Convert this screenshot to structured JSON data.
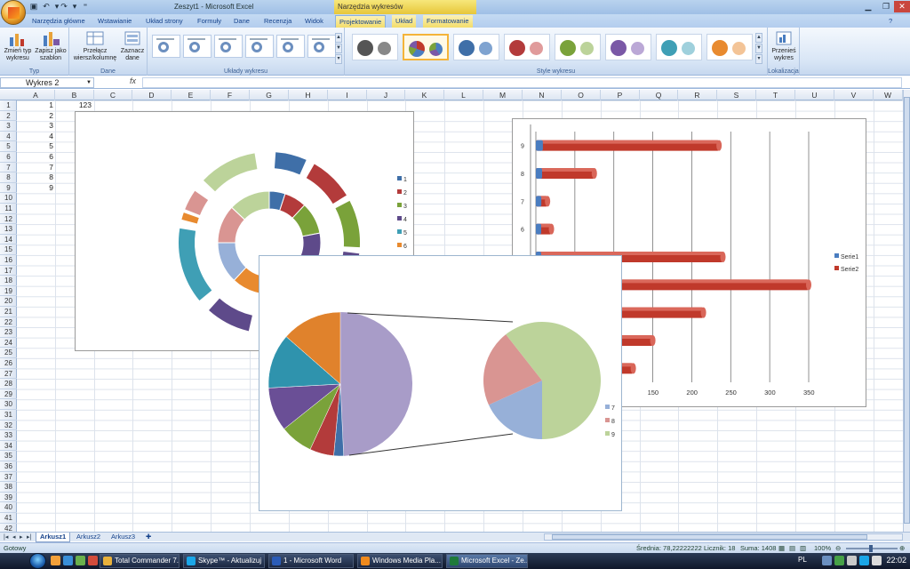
{
  "window": {
    "title": "Zeszyt1 - Microsoft Excel",
    "context_tab_title": "Narzędzia wykresów"
  },
  "ribbon": {
    "tabs": [
      {
        "label": "Narzędzia główne"
      },
      {
        "label": "Wstawianie"
      },
      {
        "label": "Układ strony"
      },
      {
        "label": "Formuły"
      },
      {
        "label": "Dane"
      },
      {
        "label": "Recenzja"
      },
      {
        "label": "Widok"
      },
      {
        "label": "Projektowanie"
      },
      {
        "label": "Układ"
      },
      {
        "label": "Formatowanie"
      }
    ],
    "active_tab": "Projektowanie",
    "groups": {
      "typ": {
        "label": "Typ",
        "change_type": "Zmień typ wykresu",
        "save_template": "Zapisz jako szablon"
      },
      "dane": {
        "label": "Dane",
        "switch_row_col": "Przełącz wiersz/kolumnę",
        "select_data": "Zaznacz dane"
      },
      "uklady": {
        "label": "Układy wykresu"
      },
      "style": {
        "label": "Style wykresu"
      },
      "lokalizacja": {
        "label": "Lokalizacja",
        "move_chart": "Przenieś wykres"
      }
    },
    "style_colors": [
      "#555555",
      "#4a7dc0",
      "#3f6fa8",
      "#b33b3b",
      "#7aa23a",
      "#7a58a6",
      "#3f9fb5",
      "#e88a2f"
    ]
  },
  "formula_bar": {
    "name_box": "Wykres 2",
    "fx": "fx",
    "value": ""
  },
  "columns": [
    "A",
    "B",
    "C",
    "D",
    "E",
    "F",
    "G",
    "H",
    "I",
    "J",
    "K",
    "L",
    "M",
    "N",
    "O",
    "P",
    "Q",
    "R",
    "S",
    "T",
    "U",
    "V",
    "W"
  ],
  "rows": [
    "1",
    "2",
    "3",
    "4",
    "5",
    "6",
    "7",
    "8",
    "9",
    "10",
    "11",
    "12",
    "13",
    "14",
    "15",
    "16",
    "17",
    "18",
    "19",
    "20",
    "21",
    "22",
    "23",
    "24",
    "25",
    "26",
    "27",
    "28",
    "29",
    "30",
    "31",
    "32",
    "33",
    "34",
    "35",
    "36",
    "37",
    "38",
    "39",
    "40",
    "41",
    "42"
  ],
  "cells": {
    "A": [
      "1",
      "2",
      "3",
      "4",
      "5",
      "6",
      "7",
      "8",
      "9"
    ],
    "B1": "123"
  },
  "chart_data": [
    {
      "type": "pie",
      "subtype": "doughnut",
      "categories": [
        "1",
        "2",
        "3",
        "4",
        "5",
        "6",
        "7",
        "8",
        "9"
      ],
      "legend_position": "right",
      "colors": [
        "#3f6fa8",
        "#b33b3b",
        "#7aa23a",
        "#5e4a8a",
        "#3f9fb5",
        "#e88a2f",
        "#97b0d8",
        "#d99592",
        "#bcd39a"
      ]
    },
    {
      "type": "bar",
      "subtype": "horizontal-3d",
      "categories": [
        "1",
        "2",
        "3",
        "4",
        "5",
        "6",
        "7",
        "8",
        "9"
      ],
      "series": [
        {
          "name": "Serie1",
          "values": [
            1,
            2,
            3,
            4,
            5,
            6,
            7,
            8,
            9
          ],
          "color": "#4a7dc0"
        },
        {
          "name": "Serie2",
          "values": [
            125,
            150,
            215,
            350,
            240,
            20,
            15,
            75,
            235
          ],
          "color": "#c0392b"
        }
      ],
      "xlim": [
        0,
        350
      ],
      "xticks": [
        "0",
        "50",
        "100",
        "150",
        "200",
        "250",
        "300",
        "350"
      ],
      "grid": true,
      "legend_position": "right"
    },
    {
      "type": "pie",
      "subtype": "pie-of-pie",
      "categories": [
        "1",
        "2",
        "3",
        "4",
        "5",
        "6",
        "7",
        "8",
        "9"
      ],
      "values": [
        9,
        22,
        30,
        40,
        50,
        55,
        60,
        70,
        200
      ],
      "legend_visible": [
        "7",
        "8",
        "9"
      ],
      "colors": [
        "#3f6fa8",
        "#b33b3b",
        "#7aa23a",
        "#6a4f96",
        "#2f93ad",
        "#e0822c",
        "#97b0d8",
        "#d99592",
        "#bcd39a"
      ],
      "main_color": "#a89cc8"
    }
  ],
  "sheets": [
    {
      "label": "Arkusz1"
    },
    {
      "label": "Arkusz2"
    },
    {
      "label": "Arkusz3"
    }
  ],
  "status": {
    "ready": "Gotowy",
    "average": "Średnia: 78,22222222",
    "count": "Licznik: 18",
    "sum": "Suma: 1408",
    "zoom": "100%"
  },
  "taskbar": {
    "tasks": [
      {
        "label": "Total Commander 7...",
        "color": "#e9b13c"
      },
      {
        "label": "Skype™ - Aktualizuj",
        "color": "#1aa6e8"
      },
      {
        "label": "1 - Microsoft Word",
        "color": "#2b5cb8"
      },
      {
        "label": "Windows Media Pla...",
        "color": "#f08a1d"
      },
      {
        "label": "Microsoft Excel - Ze...",
        "color": "#1f7a3a"
      }
    ],
    "language": "PL",
    "clock": "22:02"
  }
}
